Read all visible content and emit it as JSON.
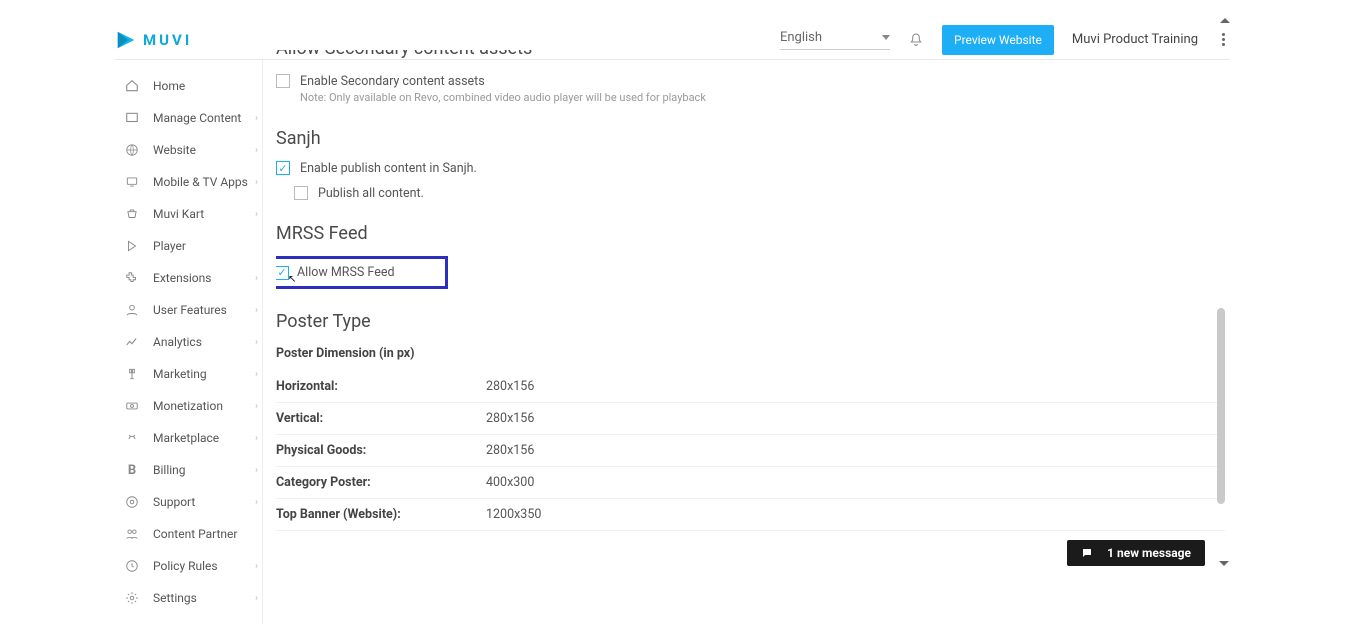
{
  "header": {
    "brand": "MUVI",
    "language": "English",
    "preview_btn": "Preview Website",
    "account_label": "Muvi Product Training"
  },
  "sidebar": {
    "items": [
      {
        "label": "Home",
        "icon": "home-icon",
        "chev": false
      },
      {
        "label": "Manage Content",
        "icon": "content-icon",
        "chev": true
      },
      {
        "label": "Website",
        "icon": "globe-icon",
        "chev": true
      },
      {
        "label": "Mobile & TV Apps",
        "icon": "mobile-icon",
        "chev": true
      },
      {
        "label": "Muvi Kart",
        "icon": "kart-icon",
        "chev": true
      },
      {
        "label": "Player",
        "icon": "player-icon",
        "chev": false
      },
      {
        "label": "Extensions",
        "icon": "extensions-icon",
        "chev": true
      },
      {
        "label": "User Features",
        "icon": "user-icon",
        "chev": true
      },
      {
        "label": "Analytics",
        "icon": "analytics-icon",
        "chev": true
      },
      {
        "label": "Marketing",
        "icon": "marketing-icon",
        "chev": true
      },
      {
        "label": "Monetization",
        "icon": "monetization-icon",
        "chev": true
      },
      {
        "label": "Marketplace",
        "icon": "marketplace-icon",
        "chev": true
      },
      {
        "label": "Billing",
        "icon": "billing-icon",
        "chev": true
      },
      {
        "label": "Support",
        "icon": "support-icon",
        "chev": true
      },
      {
        "label": "Content Partner",
        "icon": "partner-icon",
        "chev": false
      },
      {
        "label": "Policy Rules",
        "icon": "policy-icon",
        "chev": true
      },
      {
        "label": "Settings",
        "icon": "settings-icon",
        "chev": true
      }
    ]
  },
  "main": {
    "sec_assets_h": "Allow Secondary content assets",
    "sec_assets_chk": "Enable Secondary content assets",
    "sec_assets_note": "Note: Only available on Revo, combined video audio player will be used for playback",
    "sanjh_h": "Sanjh",
    "sanjh_enable": "Enable publish content in Sanjh.",
    "sanjh_publish_all": "Publish all content.",
    "mrss_h": "MRSS Feed",
    "mrss_allow": "Allow MRSS Feed",
    "poster_h": "Poster Type",
    "poster_sub": "Poster Dimension (in px)",
    "poster_rows": [
      {
        "label": "Horizontal:",
        "value": "280x156"
      },
      {
        "label": "Vertical:",
        "value": "280x156"
      },
      {
        "label": "Physical Goods:",
        "value": "280x156"
      },
      {
        "label": "Category Poster:",
        "value": "400x300"
      },
      {
        "label": "Top Banner (Website):",
        "value": "1200x350"
      }
    ]
  },
  "toast": {
    "text": "1 new message"
  }
}
